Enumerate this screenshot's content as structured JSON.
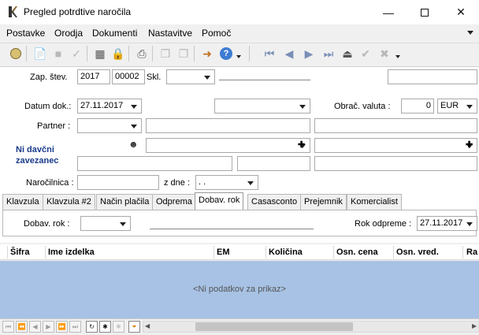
{
  "window": {
    "title": "Pregled potrdtive naročila"
  },
  "menu": [
    "Postavke",
    "Orodja",
    "Dokumenti",
    "Nastavitve",
    "Pomoč"
  ],
  "form": {
    "zap_label": "Zap. štev.",
    "zap_year": "2017",
    "zap_number": "00002",
    "skl_label": "Skl.",
    "datum_label": "Datum dok.:",
    "datum_value": "27.11.2017",
    "valuta_label": "Obrač. valuta :",
    "valuta_amount": "0",
    "valuta_currency": "EUR",
    "partner_label": "Partner :",
    "tax_status": "Ni davčni zavezanec",
    "narocilnica_label": "Naročilnica :",
    "z_dne_label": "z dne :",
    "z_dne_value": ". ."
  },
  "tabs": [
    "Klavzula",
    "Klavzula #2",
    "Način plačila",
    "Odprema",
    "Dobav. rok",
    "Casasconto",
    "Prejemnik",
    "Komercialist"
  ],
  "active_tab": "Dobav. rok",
  "tab_pane": {
    "dobav_rok_label": "Dobav. rok :",
    "rok_odpreme_label": "Rok odpreme :",
    "rok_odpreme_value": "27.11.2017"
  },
  "grid": {
    "columns": [
      "Šifra",
      "Ime izdelka",
      "EM",
      "Količina",
      "Osn. cena",
      "Osn. vred.",
      "Ra"
    ],
    "empty_text": "<Ni podatkov za prikaz>"
  },
  "colors": {
    "grid_bg": "#a7c2e4",
    "label_blue": "#1a3c8c"
  }
}
